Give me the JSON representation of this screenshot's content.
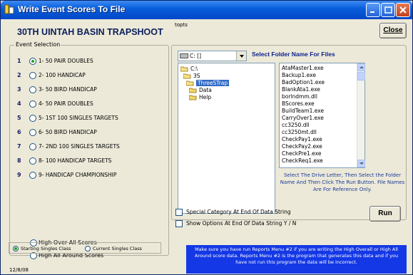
{
  "window": {
    "title": "Write Event Scores To File"
  },
  "heading": "30TH UINTAH BASIN TRAPSHOOT",
  "topts_label": "topts",
  "buttons": {
    "close": "Close",
    "run": "Run"
  },
  "event_selection": {
    "label": "Event Selection",
    "events": [
      {
        "num": "1",
        "label": "1- 50 PAIR DOUBLES",
        "selected": true
      },
      {
        "num": "2",
        "label": "2- 100 HANDICAP",
        "selected": false
      },
      {
        "num": "3",
        "label": "3- 50 BIRD HANDICAP",
        "selected": false
      },
      {
        "num": "4",
        "label": "4- 50 PAIR DOUBLES",
        "selected": false
      },
      {
        "num": "5",
        "label": "5- 1ST 100 SINGLES TARGETS",
        "selected": false
      },
      {
        "num": "6",
        "label": "6- 50 BIRD HANDICAP",
        "selected": false
      },
      {
        "num": "7",
        "label": "7- 2ND 100 SINGLES TARGETS",
        "selected": false
      },
      {
        "num": "8",
        "label": "8- 100 HANDICAP TARGETS",
        "selected": false
      },
      {
        "num": "9",
        "label": "9- HANDICAP CHAMPIONSHIP",
        "selected": false
      }
    ],
    "high_over_all": "High Over All Scores",
    "high_all_around": "High All Around Scores",
    "starting_singles_class": "Starting Singles Class",
    "current_singles_class": "Current Singles Class"
  },
  "date": "12/8/08",
  "folder": {
    "drive": "C: []",
    "caption": "Select Folder Name For Files",
    "dirs": [
      {
        "name": "C:\\",
        "selected": false
      },
      {
        "name": "3S",
        "selected": false
      },
      {
        "name": "ThreeSTrap",
        "selected": true
      },
      {
        "name": "Data",
        "selected": false
      },
      {
        "name": "Help",
        "selected": false
      }
    ],
    "files": [
      "AtaMaster1.exe",
      "Backup1.exe",
      "BadOption1.exe",
      "BlankAta1.exe",
      "borlndmm.dll",
      "BScores.exe",
      "BuildTeam1.exe",
      "CarryOver1.exe",
      "cc3250.dll",
      "cc3250mt.dll",
      "CheckPay1.exe",
      "CheckPay2.exe",
      "CheckPre1.exe",
      "CheckReq1.exe"
    ],
    "instructions": "Select The Drive Letter, Then Select the Folder Name And Then Click The Run Button. File Names Are For Reference Only."
  },
  "checks": {
    "special_category": "Special Category At End Of Data String",
    "show_options": "Show Options At End Of Data String Y / N"
  },
  "note": "Make sure you have run Reports Menu #2 if you are writing the High Overall or High All Around score data. Reports Menu #2 is the program that generates this data and if you have not run this program the data will be incorrect."
}
